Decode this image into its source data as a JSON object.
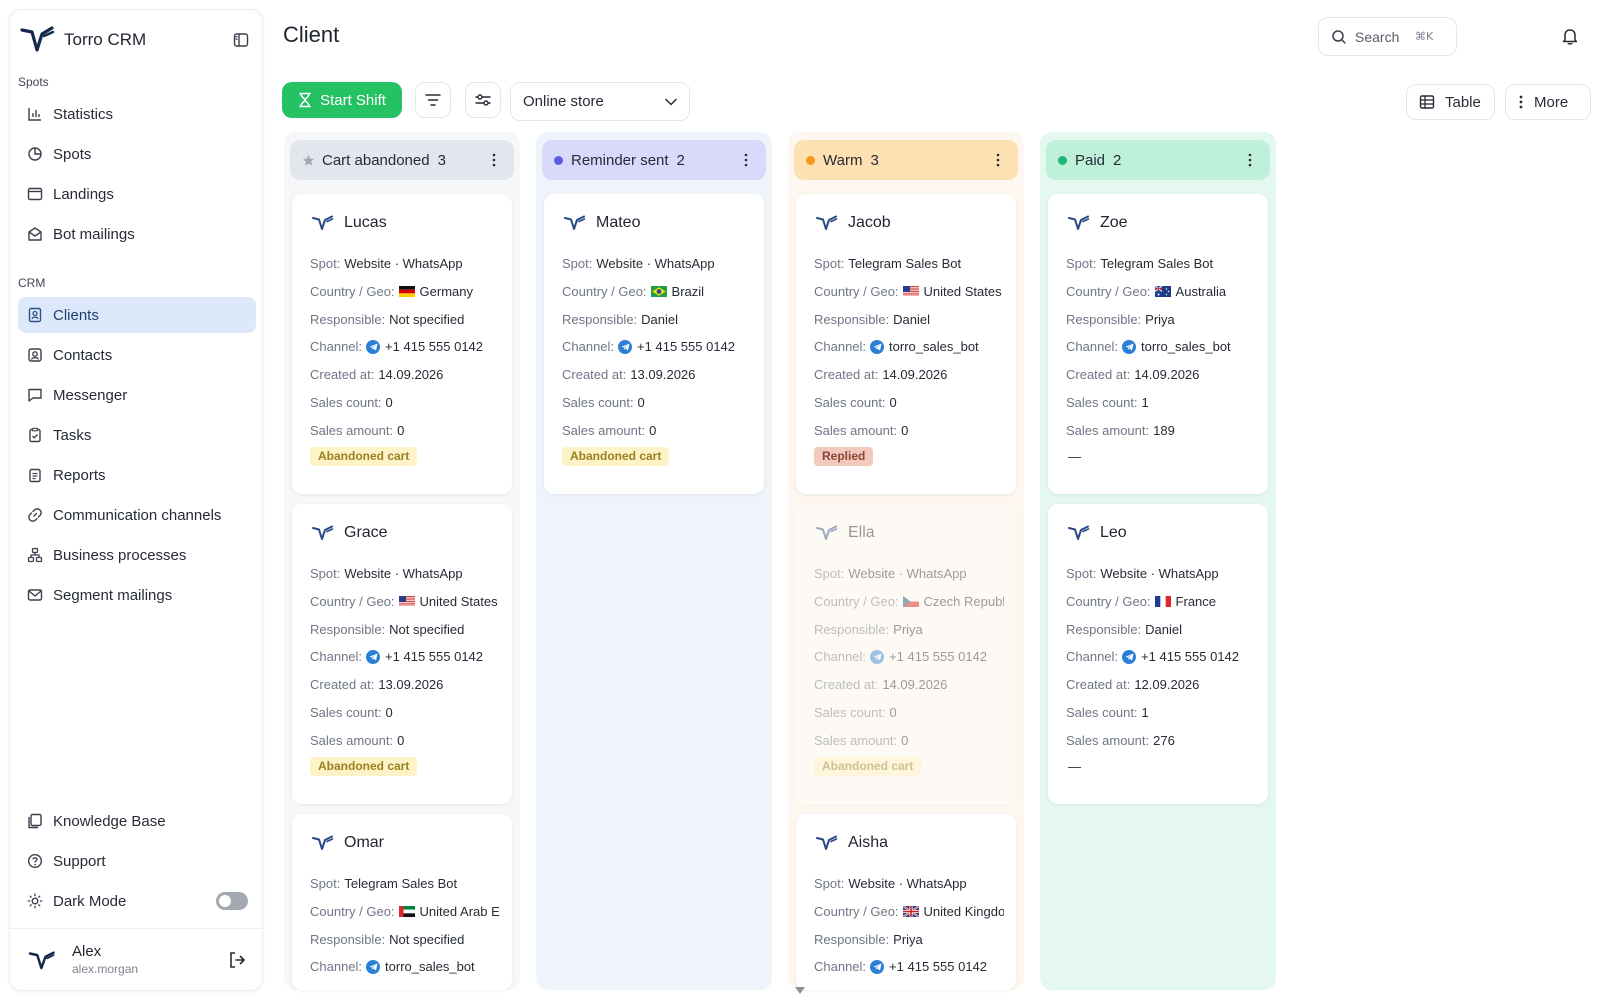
{
  "app": {
    "name": "Torro CRM"
  },
  "sidebar": {
    "sections": [
      {
        "label": "Spots",
        "items": [
          {
            "label": "Statistics",
            "icon": "bar-chart-icon"
          },
          {
            "label": "Spots",
            "icon": "pie-chart-icon"
          },
          {
            "label": "Landings",
            "icon": "browser-icon"
          },
          {
            "label": "Bot mailings",
            "icon": "mail-open-icon"
          }
        ]
      },
      {
        "label": "CRM",
        "items": [
          {
            "label": "Clients",
            "icon": "client-card-icon",
            "active": true
          },
          {
            "label": "Contacts",
            "icon": "contact-icon"
          },
          {
            "label": "Messenger",
            "icon": "chat-icon"
          },
          {
            "label": "Tasks",
            "icon": "clipboard-icon"
          },
          {
            "label": "Reports",
            "icon": "report-icon"
          },
          {
            "label": "Communication channels",
            "icon": "link-icon"
          },
          {
            "label": "Business processes",
            "icon": "workflow-icon"
          },
          {
            "label": "Segment mailings",
            "icon": "mail-icon"
          }
        ]
      }
    ],
    "bottom": [
      {
        "label": "Knowledge Base",
        "icon": "book-icon"
      },
      {
        "label": "Support",
        "icon": "help-icon"
      },
      {
        "label": "Dark Mode",
        "icon": "sun-icon",
        "toggle": false
      }
    ],
    "user": {
      "name": "Alex",
      "email": "alex.morgan"
    }
  },
  "header": {
    "title": "Client",
    "search_placeholder": "Search",
    "search_shortcut": "⌘K"
  },
  "toolbar": {
    "start_shift": "Start Shift",
    "store_select": "Online store",
    "view_label": "Table",
    "more_label": "More"
  },
  "field_labels": {
    "spot": "Spot:",
    "country": "Country / Geo:",
    "responsible": "Responsible:",
    "channel": "Channel:",
    "created": "Created at:",
    "sales_count": "Sales count:",
    "sales_amount": "Sales amount:"
  },
  "columns": [
    {
      "title": "Cart abandoned",
      "count": "3",
      "head_bg": "#e3e6ec",
      "col_bg": "#f6f7f9",
      "marker": "star",
      "dot_color": "#a4a9b3",
      "cards": [
        {
          "name": "Lucas",
          "spot": "Website · WhatsApp",
          "country": "Germany",
          "flag": "de",
          "responsible": "Not specified",
          "channel": "+1 415 555 0142",
          "created": "14.09.2026",
          "sales_count": "0",
          "sales_amount": "0",
          "tag": "Abandoned cart",
          "tag_style": "yellow"
        },
        {
          "name": "Grace",
          "spot": "Website · WhatsApp",
          "country": "United States",
          "flag": "us",
          "responsible": "Not specified",
          "channel": "+1 415 555 0142",
          "created": "13.09.2026",
          "sales_count": "0",
          "sales_amount": "0",
          "tag": "Abandoned cart",
          "tag_style": "yellow"
        },
        {
          "name": "Omar",
          "spot": "Telegram Sales Bot",
          "country": "United Arab Emirates",
          "flag": "ae",
          "responsible": "Not specified",
          "channel": "torro_sales_bot"
        }
      ]
    },
    {
      "title": "Reminder sent",
      "count": "2",
      "head_bg": "#d9d9fb",
      "col_bg": "#eff4fb",
      "marker": "dot",
      "dot_color": "#5b5de0",
      "cards": [
        {
          "name": "Mateo",
          "spot": "Website · WhatsApp",
          "country": "Brazil",
          "flag": "br",
          "responsible": "Daniel",
          "channel": "+1 415 555 0142",
          "created": "13.09.2026",
          "sales_count": "0",
          "sales_amount": "0",
          "tag": "Abandoned cart",
          "tag_style": "yellow"
        }
      ]
    },
    {
      "title": "Warm",
      "count": "3",
      "head_bg": "#fde1b3",
      "col_bg": "#fdf7ef",
      "marker": "dot",
      "dot_color": "#f39a16",
      "cards": [
        {
          "name": "Jacob",
          "spot": "Telegram Sales Bot",
          "country": "United States",
          "flag": "us",
          "responsible": "Daniel",
          "channel": "torro_sales_bot",
          "created": "14.09.2026",
          "sales_count": "0",
          "sales_amount": "0",
          "tag": "Replied",
          "tag_style": "red"
        },
        {
          "name": "Ella",
          "spot": "Website · WhatsApp",
          "country": "Czech Republic",
          "flag": "cz",
          "responsible": "Priya",
          "channel": "+1 415 555 0142",
          "created": "14.09.2026",
          "sales_count": "0",
          "sales_amount": "0",
          "tag": "Abandoned cart",
          "tag_style": "yellow",
          "faded": true
        },
        {
          "name": "Aisha",
          "spot": "Website · WhatsApp",
          "country": "United Kingdom",
          "flag": "gb",
          "responsible": "Priya",
          "channel": "+1 415 555 0142"
        }
      ]
    },
    {
      "title": "Paid",
      "count": "2",
      "head_bg": "#bff0da",
      "col_bg": "#e5f7f1",
      "marker": "dot",
      "dot_color": "#1fb676",
      "cards": [
        {
          "name": "Zoe",
          "spot": "Telegram Sales Bot",
          "country": "Australia",
          "flag": "au",
          "responsible": "Priya",
          "channel": "torro_sales_bot",
          "created": "14.09.2026",
          "sales_count": "1",
          "sales_amount": "189",
          "tag": "—",
          "tag_style": "dash"
        },
        {
          "name": "Leo",
          "spot": "Website · WhatsApp",
          "country": "France",
          "flag": "fr",
          "responsible": "Daniel",
          "channel": "+1 415 555 0142",
          "created": "12.09.2026",
          "sales_count": "1",
          "sales_amount": "276",
          "tag": "—",
          "tag_style": "dash"
        }
      ]
    }
  ]
}
